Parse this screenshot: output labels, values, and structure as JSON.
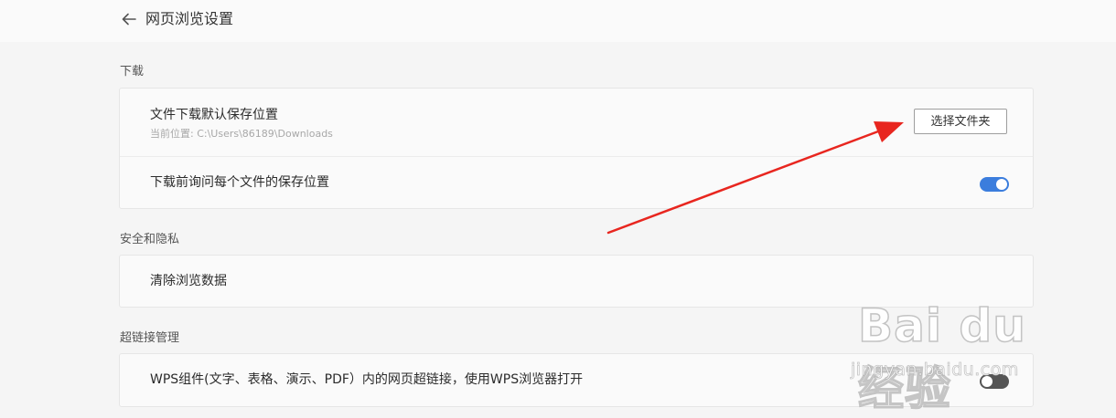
{
  "header": {
    "title": "网页浏览设置",
    "back_icon": "arrow-left-icon"
  },
  "sections": {
    "download": {
      "label": "下载",
      "save_location": {
        "title": "文件下载默认保存位置",
        "current_path": "当前位置: C:\\Users\\86189\\Downloads",
        "button_label": "选择文件夹"
      },
      "ask_before_download": {
        "title": "下载前询问每个文件的保存位置",
        "enabled": true
      }
    },
    "privacy": {
      "label": "安全和隐私",
      "clear_data": {
        "title": "清除浏览数据"
      }
    },
    "hyperlink": {
      "label": "超链接管理",
      "wps_links": {
        "title": "WPS组件(文字、表格、演示、PDF）内的网页超链接，使用WPS浏览器打开",
        "enabled": false
      }
    }
  },
  "watermark": {
    "logo": "Bai du 经验",
    "url": "jingyan.baidu.com"
  },
  "colors": {
    "accent": "#3b7ddd",
    "annotation_arrow": "#e8261f",
    "toggle_off": "#555555"
  }
}
